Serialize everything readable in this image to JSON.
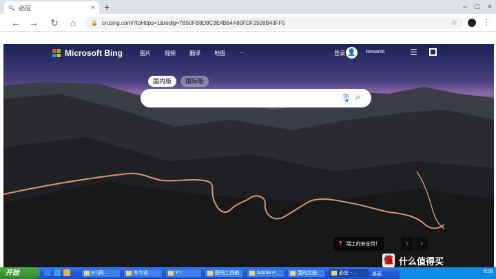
{
  "browser": {
    "tab_title": "必应",
    "tab_icon": "search-icon",
    "url": "cn.bing.com/?toHttps=1&redig=7B50FB8D9C3E4B64A80FDF2508B43FF5"
  },
  "bing": {
    "brand": "Microsoft Bing",
    "nav": [
      "图片",
      "视频",
      "翻译",
      "地图",
      "···"
    ],
    "signin": "登录",
    "rewards": "Rewards",
    "scope_tabs": [
      "国内版",
      "国际版"
    ],
    "image_caption": "瑞士的安全带！"
  },
  "taskbar": {
    "start_label": "开始",
    "buttons": [
      "E:\\[周...",
      "冬今花 ...",
      "F:\\",
      "图吧工具箱",
      "Adobe P...",
      "我的文档",
      "必应 - ..."
    ],
    "desktop_label": "桌面",
    "clock": "6:06"
  },
  "watermark": {
    "badge": "值",
    "text": "什么值得买"
  },
  "colors": {
    "accent": "#1a73e8",
    "taskbar": "#245edb",
    "start": "#2f8a2b"
  }
}
